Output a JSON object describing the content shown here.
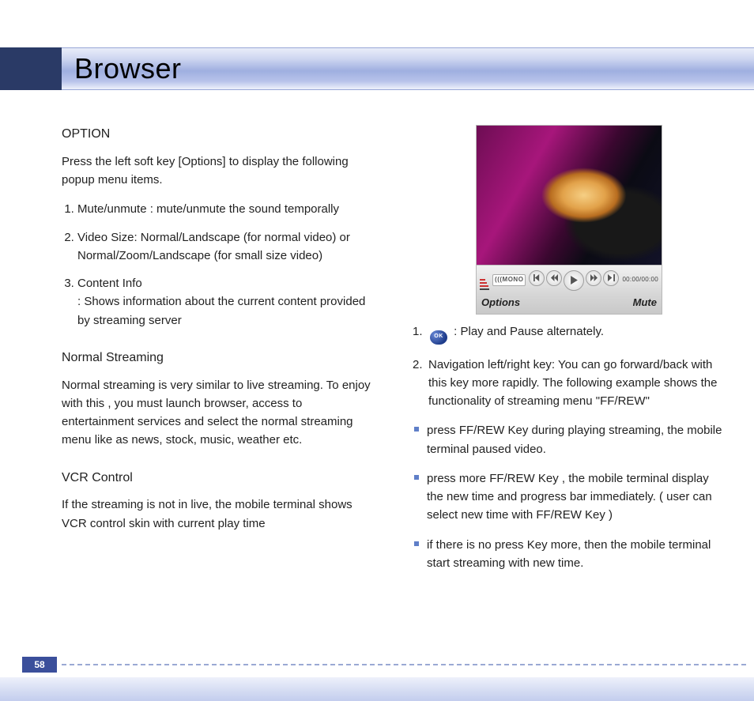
{
  "title": "Browser",
  "page_number": "58",
  "left": {
    "option_h": "OPTION",
    "option_intro": "Press the left soft key [Options] to display the following popup menu items.",
    "option_items": {
      "i1": "Mute/unmute : mute/unmute the sound temporally",
      "i2": "Video Size: Normal/Landscape (for normal video) or Normal/Zoom/Landscape (for small size video)",
      "i3a": "Content Info",
      "i3b": ": Shows information about the current content provided by streaming server"
    },
    "ns_h": "Normal Streaming",
    "ns_p": "Normal streaming is very similar to live streaming. To enjoy with this , you must launch browser, access to entertainment services and select the normal streaming menu like as news, stock, music, weather etc.",
    "vcr_h": "VCR Control",
    "vcr_p": "If the streaming is not in live, the mobile terminal shows VCR control skin with current play time"
  },
  "shot": {
    "mono": "(((MONO",
    "time": "00:00/00:00",
    "soft_left": "Options",
    "soft_right": "Mute"
  },
  "right": {
    "n1_ok": "OK",
    "n1_rest": " : Play and Pause alternately.",
    "n2": "Navigation left/right key: You can go forward/back with this key more rapidly. The following example shows the functionality of streaming menu \"FF/REW\"",
    "b1": "press FF/REW Key during playing streaming, the mobile terminal paused video.",
    "b2": "press more FF/REW Key , the mobile terminal display the new time and progress bar immediately. ( user can select new time with FF/REW Key )",
    "b3": "if there is no press Key more, then the mobile terminal start streaming with new time."
  }
}
